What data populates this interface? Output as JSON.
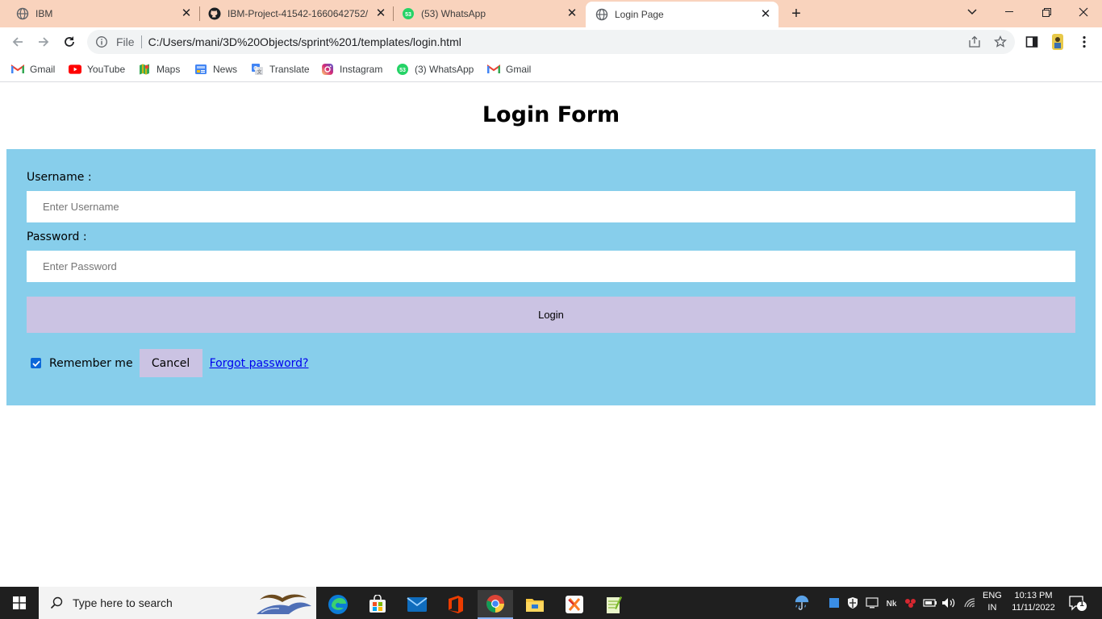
{
  "browser": {
    "tabs": [
      {
        "title": "IBM",
        "icon": "globe-icon",
        "active": false
      },
      {
        "title": "IBM-Project-41542-1660642752/",
        "icon": "github-icon",
        "active": false
      },
      {
        "title": "(53) WhatsApp",
        "icon": "whatsapp-icon",
        "badge": "53",
        "active": false
      },
      {
        "title": "Login Page",
        "icon": "globe-icon",
        "active": true
      }
    ],
    "address": {
      "scheme": "File",
      "url": "C:/Users/mani/3D%20Objects/sprint%201/templates/login.html"
    },
    "bookmarks": [
      {
        "label": "Gmail",
        "icon": "gmail-icon"
      },
      {
        "label": "YouTube",
        "icon": "youtube-icon"
      },
      {
        "label": "Maps",
        "icon": "maps-icon"
      },
      {
        "label": "News",
        "icon": "news-icon"
      },
      {
        "label": "Translate",
        "icon": "translate-icon"
      },
      {
        "label": "Instagram",
        "icon": "instagram-icon"
      },
      {
        "label": "(3) WhatsApp",
        "icon": "whatsapp-icon",
        "badge": "53"
      },
      {
        "label": "Gmail",
        "icon": "gmail-icon"
      }
    ]
  },
  "page": {
    "heading": "Login Form",
    "username_label": "Username :",
    "username_placeholder": "Enter Username",
    "username_value": "",
    "password_label": "Password :",
    "password_placeholder": "Enter Password",
    "password_value": "",
    "login_label": "Login",
    "remember_label": "Remember me",
    "remember_checked": true,
    "cancel_label": "Cancel",
    "forgot_label": "Forgot password?"
  },
  "colors": {
    "tabstrip": "#f9d3bd",
    "form_background": "#87ceeb",
    "button_background": "#cbc3e3",
    "link": "#0000ee",
    "taskbar": "#1f1f1f"
  },
  "taskbar": {
    "search_placeholder": "Type here to search",
    "apps": [
      "edge-icon",
      "store-icon",
      "mail-icon",
      "office-icon",
      "chrome-icon",
      "file-explorer-icon",
      "xampp-icon",
      "notepad-plus-icon"
    ],
    "active_app": "chrome-icon",
    "language_line1": "ENG",
    "language_line2": "IN",
    "time": "10:13 PM",
    "date": "11/11/2022",
    "notification_count": "1"
  }
}
